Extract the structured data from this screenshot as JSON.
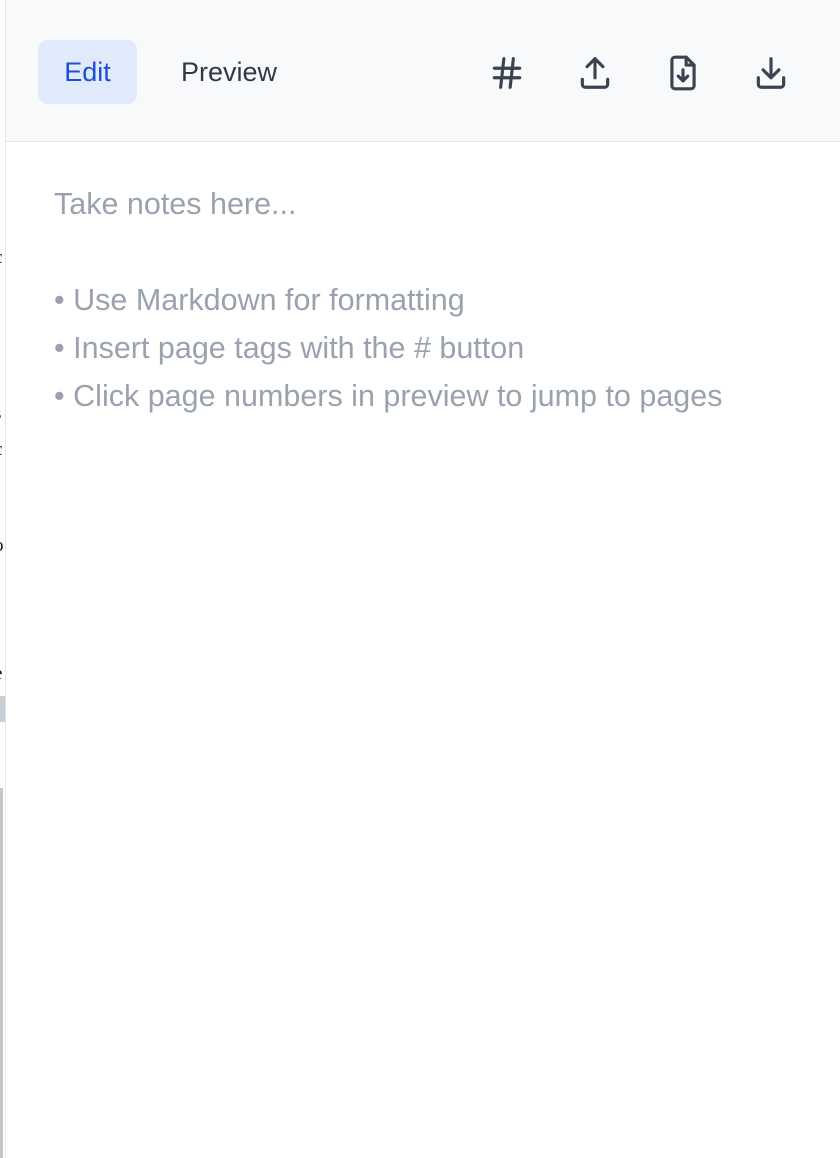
{
  "background_doc": {
    "fragments": [
      "c",
      "t",
      "s",
      "c",
      "o",
      "e"
    ]
  },
  "toolbar": {
    "tabs": [
      {
        "label": "Edit",
        "active": true
      },
      {
        "label": "Preview",
        "active": false
      }
    ],
    "actions": [
      {
        "name": "insert-tag",
        "icon": "hash-icon"
      },
      {
        "name": "export",
        "icon": "upload-icon"
      },
      {
        "name": "import",
        "icon": "file-import-icon"
      },
      {
        "name": "download",
        "icon": "download-icon"
      }
    ]
  },
  "editor": {
    "value": "",
    "placeholder_lines": {
      "intro": "Take notes here...",
      "tip1": "• Use Markdown for formatting",
      "tip2": "• Insert page tags with the # button",
      "tip3": "• Click page numbers in preview to jump to pages"
    }
  },
  "colors": {
    "accent": "#1d4ed8",
    "active_tab_bg": "#e1eafb",
    "toolbar_bg": "#f8f9fb",
    "placeholder_text": "#9aa2ad",
    "icon": "#3b4350"
  }
}
